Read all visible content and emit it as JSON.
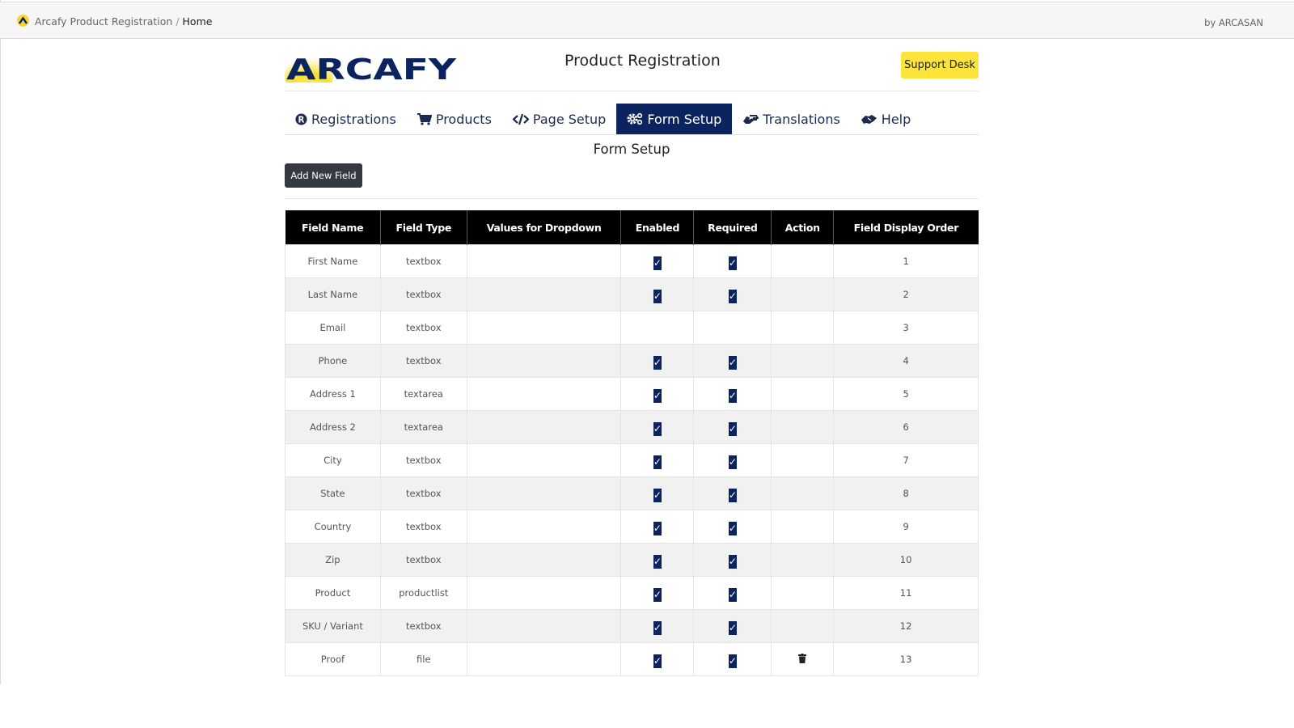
{
  "topbar": {
    "app_name": "Arcafy Product Registration",
    "separator": "/",
    "current": "Home",
    "byline": "by ARCASAN"
  },
  "header": {
    "logo_text": "ARCAFY",
    "title": "Product Registration",
    "support_label": "Support Desk"
  },
  "colors": {
    "brand_navy": "#0b2460",
    "brand_yellow": "#fde43b",
    "header_black": "#000000",
    "button_dark": "#353a40"
  },
  "tabs": [
    {
      "label": "Registrations",
      "icon": "registered-icon",
      "active": false
    },
    {
      "label": "Products",
      "icon": "cart-icon",
      "active": false
    },
    {
      "label": "Page Setup",
      "icon": "code-icon",
      "active": false
    },
    {
      "label": "Form Setup",
      "icon": "cogs-icon",
      "active": true
    },
    {
      "label": "Translations",
      "icon": "sign-language-icon",
      "active": false
    },
    {
      "label": "Help",
      "icon": "handshake-icon",
      "active": false
    }
  ],
  "section": {
    "title": "Form Setup",
    "add_button": "Add New Field"
  },
  "table": {
    "columns": [
      "Field Name",
      "Field Type",
      "Values for Dropdown",
      "Enabled",
      "Required",
      "Action",
      "Field Display Order"
    ],
    "rows": [
      {
        "name": "First Name",
        "type": "textbox",
        "values": "",
        "enabled": true,
        "required": true,
        "deletable": false,
        "order": "1"
      },
      {
        "name": "Last Name",
        "type": "textbox",
        "values": "",
        "enabled": true,
        "required": true,
        "deletable": false,
        "order": "2"
      },
      {
        "name": "Email",
        "type": "textbox",
        "values": "",
        "enabled": null,
        "required": null,
        "deletable": false,
        "order": "3"
      },
      {
        "name": "Phone",
        "type": "textbox",
        "values": "",
        "enabled": true,
        "required": true,
        "deletable": false,
        "order": "4"
      },
      {
        "name": "Address 1",
        "type": "textarea",
        "values": "",
        "enabled": true,
        "required": true,
        "deletable": false,
        "order": "5"
      },
      {
        "name": "Address 2",
        "type": "textarea",
        "values": "",
        "enabled": true,
        "required": true,
        "deletable": false,
        "order": "6"
      },
      {
        "name": "City",
        "type": "textbox",
        "values": "",
        "enabled": true,
        "required": true,
        "deletable": false,
        "order": "7"
      },
      {
        "name": "State",
        "type": "textbox",
        "values": "",
        "enabled": true,
        "required": true,
        "deletable": false,
        "order": "8"
      },
      {
        "name": "Country",
        "type": "textbox",
        "values": "",
        "enabled": true,
        "required": true,
        "deletable": false,
        "order": "9"
      },
      {
        "name": "Zip",
        "type": "textbox",
        "values": "",
        "enabled": true,
        "required": true,
        "deletable": false,
        "order": "10"
      },
      {
        "name": "Product",
        "type": "productlist",
        "values": "",
        "enabled": true,
        "required": true,
        "deletable": false,
        "order": "11"
      },
      {
        "name": "SKU / Variant",
        "type": "textbox",
        "values": "",
        "enabled": true,
        "required": true,
        "deletable": false,
        "order": "12"
      },
      {
        "name": "Proof",
        "type": "file",
        "values": "",
        "enabled": true,
        "required": true,
        "deletable": true,
        "order": "13"
      }
    ]
  }
}
